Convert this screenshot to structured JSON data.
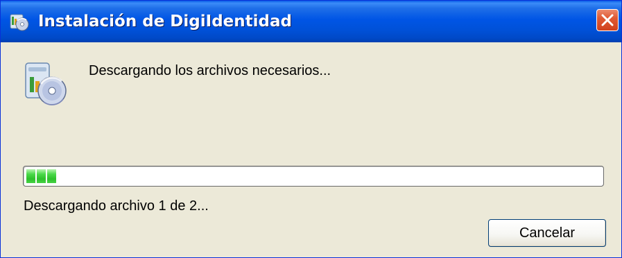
{
  "window": {
    "title": "Instalación de DigiIdentidad",
    "icon": "installer-icon",
    "close_icon": "close-icon"
  },
  "main": {
    "icon": "installer-cd-icon",
    "message": "Descargando los archivos necesarios..."
  },
  "progress": {
    "fraction": 0.06,
    "fill_color": "#2dc12b"
  },
  "status": {
    "text": "Descargando archivo 1 de 2..."
  },
  "buttons": {
    "cancel_label": "Cancelar"
  },
  "colors": {
    "titlebar": "#0055e5",
    "dialog_bg": "#ece9d8",
    "close_button": "#d0411d"
  }
}
